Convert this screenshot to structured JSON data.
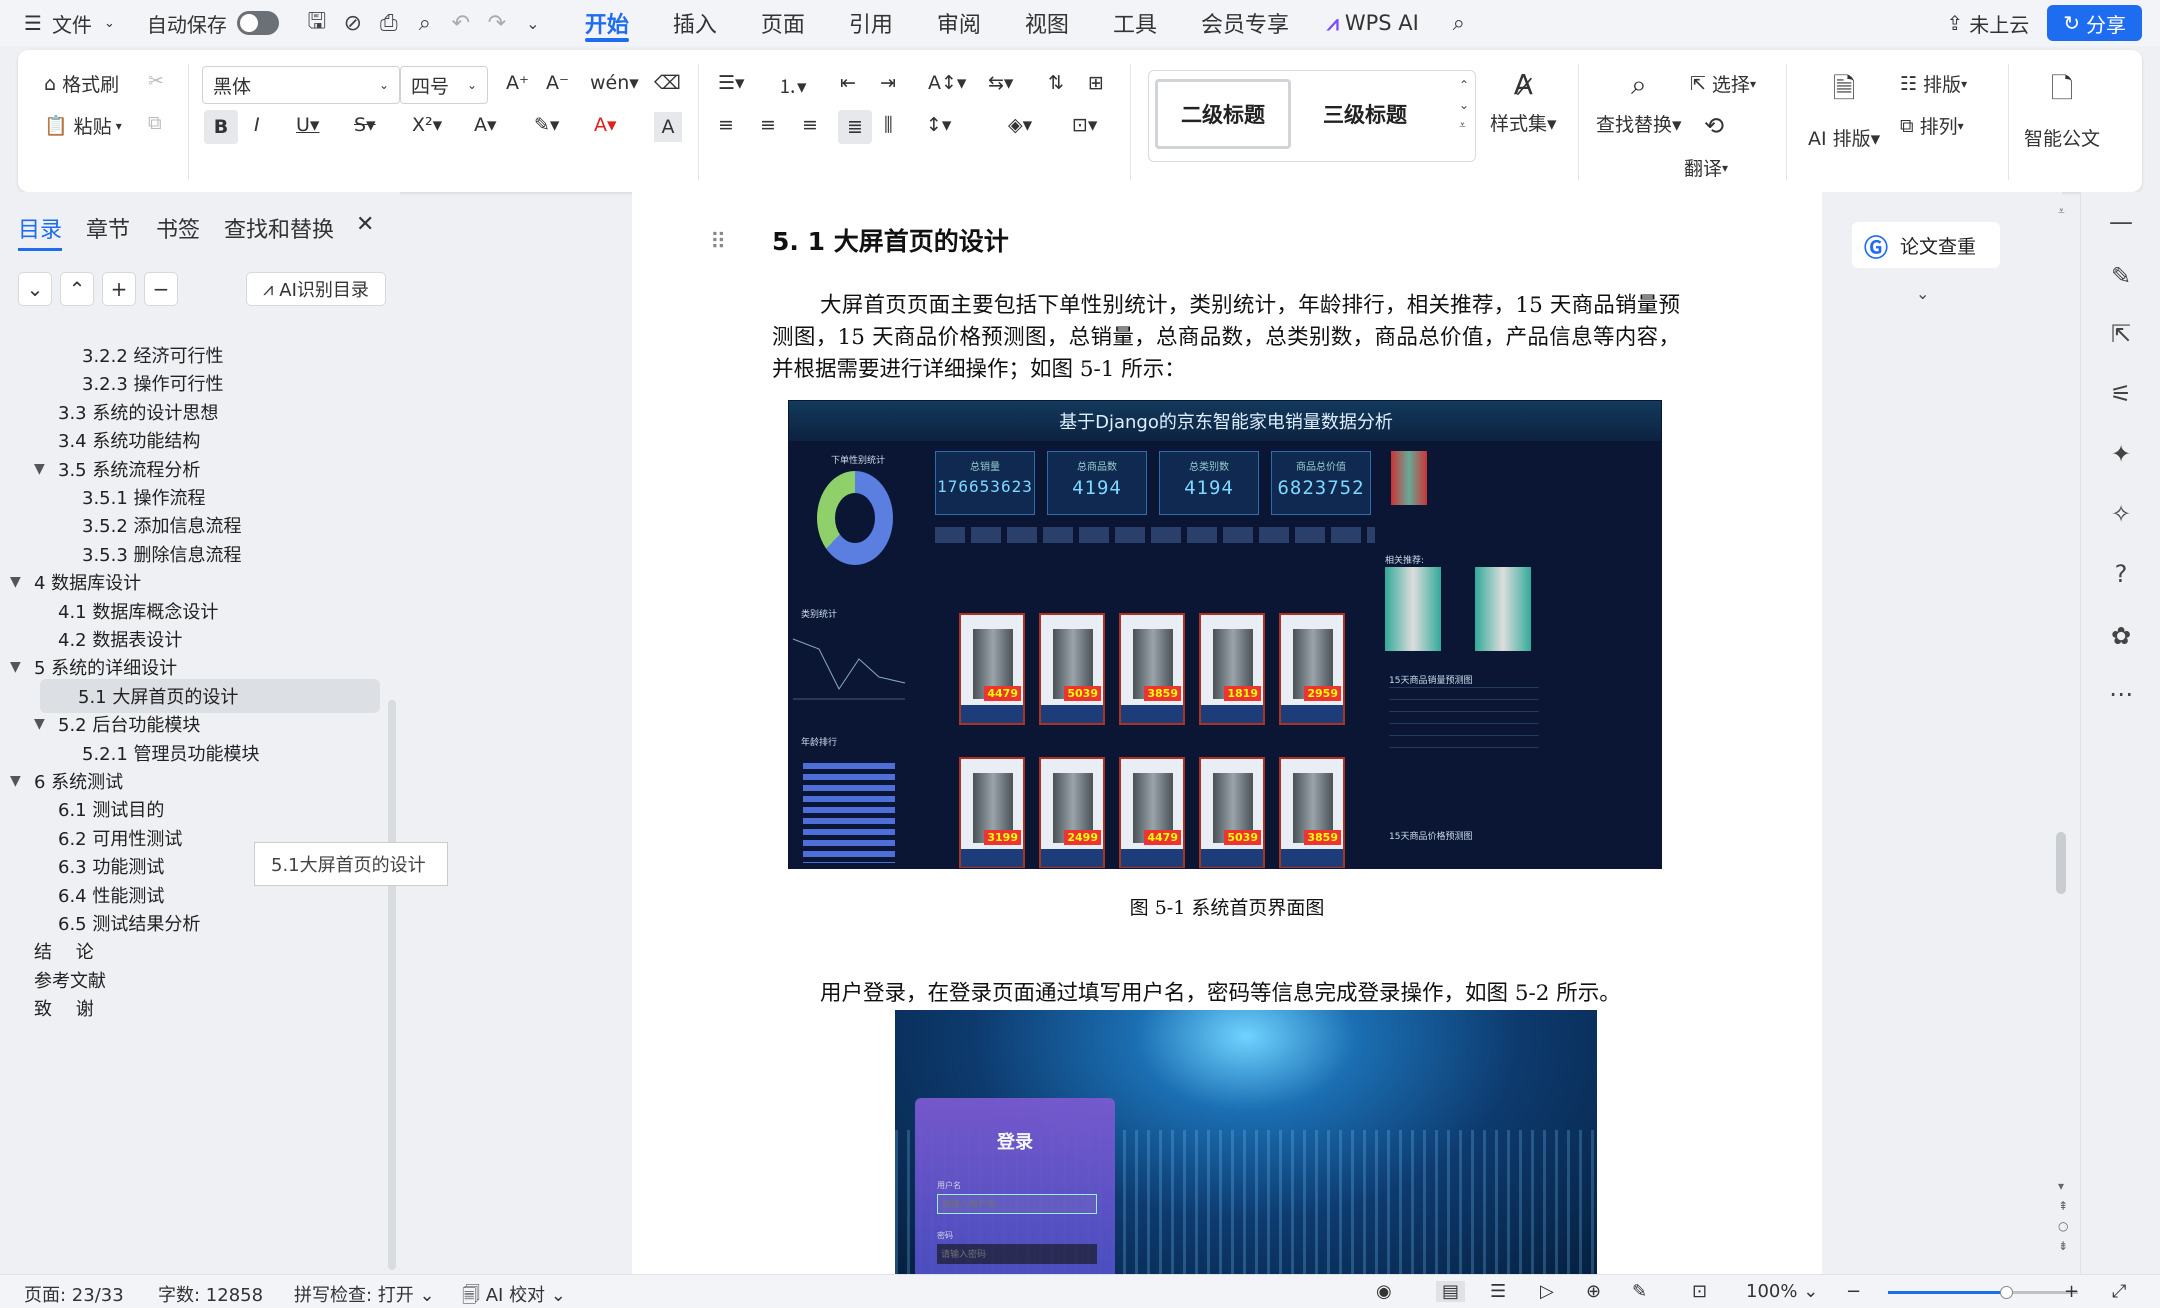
{
  "menubar": {
    "file_label": "文件",
    "autosave_label": "自动保存",
    "tabs": [
      "开始",
      "插入",
      "页面",
      "引用",
      "审阅",
      "视图",
      "工具",
      "会员专享"
    ],
    "wps_ai_label": "WPS AI",
    "cloud_label": "未上云",
    "share_label": "分享"
  },
  "ribbon": {
    "format_painter": "格式刷",
    "paste": "粘贴",
    "font_name": "黑体",
    "font_size": "四号",
    "style_h2": "二级标题",
    "style_h3": "三级标题",
    "style_set": "样式集",
    "find_replace": "查找替换",
    "select": "选择",
    "translate": "翻译",
    "ai_layout": "AI 排版",
    "layout": "排版",
    "arrange": "排列",
    "smart_doc": "智能公文"
  },
  "nav": {
    "tabs": [
      "目录",
      "章节",
      "书签",
      "查找和替换"
    ],
    "ai_toc_label": "AI识别目录",
    "tooltip": "5.1大屏首页的设计",
    "items": [
      {
        "label": "3.2.2 经济可行性",
        "level": 3,
        "arrow": ""
      },
      {
        "label": "3.2.3 操作可行性",
        "level": 3,
        "arrow": ""
      },
      {
        "label": "3.3 系统的设计思想",
        "level": 2,
        "arrow": ""
      },
      {
        "label": "3.4 系统功能结构",
        "level": 2,
        "arrow": ""
      },
      {
        "label": "3.5 系统流程分析",
        "level": 2,
        "arrow": "▼"
      },
      {
        "label": "3.5.1 操作流程",
        "level": 3,
        "arrow": ""
      },
      {
        "label": "3.5.2 添加信息流程",
        "level": 3,
        "arrow": ""
      },
      {
        "label": "3.5.3 删除信息流程",
        "level": 3,
        "arrow": ""
      },
      {
        "label": "4 数据库设计",
        "level": 1,
        "arrow": "▼"
      },
      {
        "label": "4.1 数据库概念设计",
        "level": 2,
        "arrow": ""
      },
      {
        "label": "4.2 数据表设计",
        "level": 2,
        "arrow": ""
      },
      {
        "label": "5 系统的详细设计",
        "level": 1,
        "arrow": "▼"
      },
      {
        "label": "5.1 大屏首页的设计",
        "level": 2,
        "arrow": "",
        "selected": true
      },
      {
        "label": "5.2 后台功能模块",
        "level": 2,
        "arrow": "▼"
      },
      {
        "label": "5.2.1 管理员功能模块",
        "level": 3,
        "arrow": ""
      },
      {
        "label": "6 系统测试",
        "level": 1,
        "arrow": "▼"
      },
      {
        "label": "6.1 测试目的",
        "level": 2,
        "arrow": ""
      },
      {
        "label": "6.2 可用性测试",
        "level": 2,
        "arrow": ""
      },
      {
        "label": "6.3 功能测试",
        "level": 2,
        "arrow": ""
      },
      {
        "label": "6.4 性能测试",
        "level": 2,
        "arrow": ""
      },
      {
        "label": "6.5 测试结果分析",
        "level": 2,
        "arrow": ""
      },
      {
        "label": "结　 论",
        "level": 1,
        "arrow": ""
      },
      {
        "label": "参考文献",
        "level": 1,
        "arrow": ""
      },
      {
        "label": "致　 谢",
        "level": 1,
        "arrow": ""
      }
    ]
  },
  "doc": {
    "heading": "5. 1 大屏首页的设计",
    "para1": "大屏首页页面主要包括下单性别统计，类别统计，年龄排行，相关推荐，15 天商品销量预测图，15 天商品价格预测图，总销量，总商品数，总类别数，商品总价值，产品信息等内容，并根据需要进行详细操作；如图 5-1 所示：",
    "caption1": "图 5-1 系统首页界面图",
    "para2": "用户登录，在登录页面通过填写用户名，密码等信息完成登录操作，如图 5-2 所示。",
    "dashboard": {
      "title": "基于Django的京东智能家电销量数据分析",
      "kpis": [
        {
          "label": "总销量",
          "value": "176653623"
        },
        {
          "label": "总商品数",
          "value": "4194"
        },
        {
          "label": "总类别数",
          "value": "4194"
        },
        {
          "label": "商品总价值",
          "value": "6823752"
        }
      ],
      "gender_title": "下单性别统计",
      "category_title": "类别统计",
      "age_title": "年龄排行",
      "related_title": "相关推荐:",
      "sales_forecast_title": "15天商品销量预测图",
      "price_forecast_title": "15天商品价格预测图",
      "prices": [
        "4479",
        "5039",
        "3859",
        "1819",
        "2959",
        "3199",
        "2499"
      ]
    },
    "login": {
      "title": "登录",
      "username_label": "用户名",
      "username_placeholder": "请输入用户名",
      "password_label": "密码",
      "password_placeholder": "请输入密码"
    }
  },
  "right_panel": {
    "paper_check_label": "论文查重"
  },
  "status": {
    "page": "页面: 23/33",
    "words": "字数: 12858",
    "spell": "拼写检查: 打开",
    "ai_check": "AI 校对",
    "zoom": "100%"
  }
}
